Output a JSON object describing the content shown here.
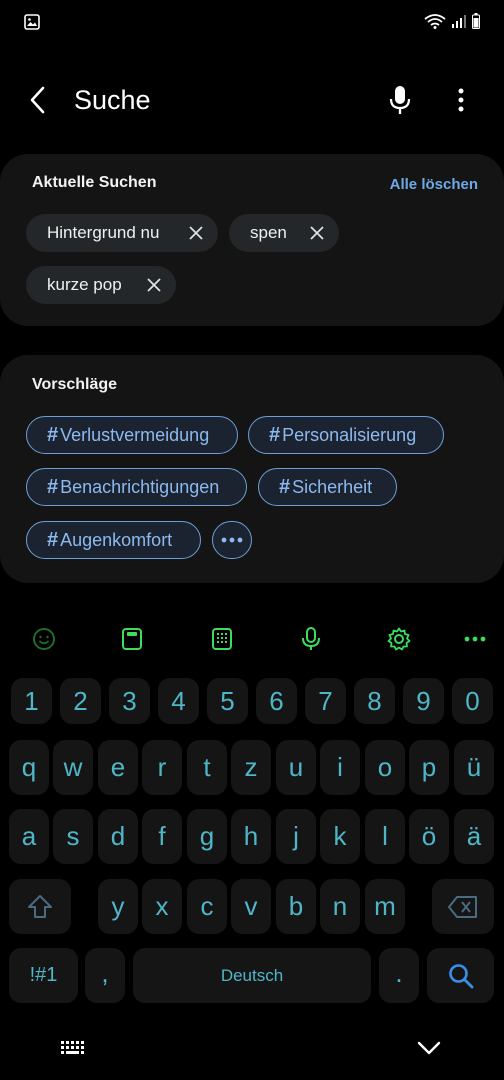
{
  "status": {
    "icons": [
      "gallery-icon",
      "wifi-icon",
      "signal-icon",
      "battery-icon"
    ]
  },
  "header": {
    "title": "Suche",
    "icons": [
      "back-icon",
      "microphone-icon",
      "more-vert-icon"
    ]
  },
  "recent": {
    "title": "Aktuelle Suchen",
    "clear_all": "Alle löschen",
    "chips": [
      "Hintergrund nu",
      "spen",
      "kurze pop"
    ]
  },
  "suggestions": {
    "title": "Vorschläge",
    "tags": [
      "Verlustvermeidung",
      "Personalisierung",
      "Benachrichtigungen",
      "Sicherheit",
      "Augenkomfort"
    ],
    "hash": "#"
  },
  "keyboard": {
    "toolbar": [
      "emoji-icon",
      "clipboard-icon",
      "keypad-icon",
      "voice-input-icon",
      "settings-icon",
      "more-horiz-icon"
    ],
    "row_numbers": [
      "1",
      "2",
      "3",
      "4",
      "5",
      "6",
      "7",
      "8",
      "9",
      "0"
    ],
    "row1": [
      "q",
      "w",
      "e",
      "r",
      "t",
      "z",
      "u",
      "i",
      "o",
      "p",
      "ü"
    ],
    "row2": [
      "a",
      "s",
      "d",
      "f",
      "g",
      "h",
      "j",
      "k",
      "l",
      "ö",
      "ä"
    ],
    "row3": [
      "y",
      "x",
      "c",
      "v",
      "b",
      "n",
      "m"
    ],
    "symbols_key": "!#1",
    "comma_key": ",",
    "space_label": "Deutsch",
    "period_key": ".",
    "key_color": "#4fb6c8",
    "toolbar_color": "#3ddc5a"
  },
  "navbar": {
    "icons": [
      "keyboard-switch-icon",
      "hide-keyboard-icon"
    ]
  }
}
